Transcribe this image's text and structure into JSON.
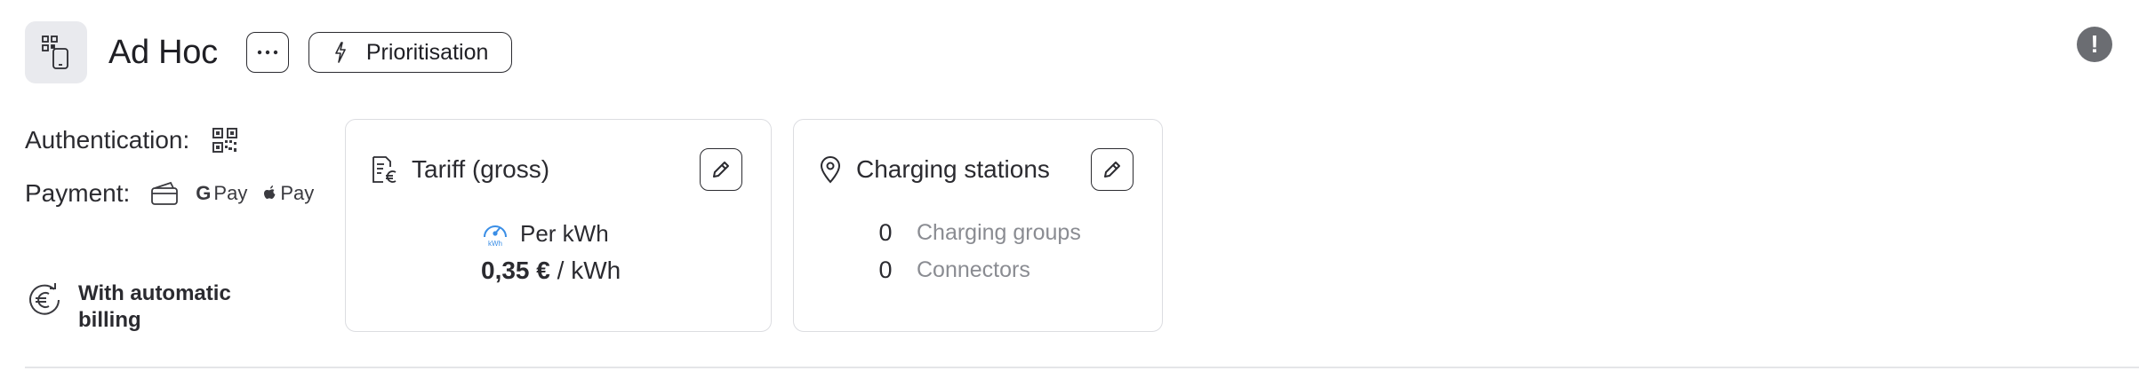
{
  "header": {
    "title": "Ad Hoc",
    "prioritisation_label": "Prioritisation",
    "app_icon": "qr-phone-icon",
    "more_icon": "ellipsis-icon",
    "prio_icon": "lightning-icon",
    "alert_icon": "exclamation-icon",
    "alert_symbol": "!"
  },
  "info": {
    "authentication_label": "Authentication:",
    "payment_label": "Payment:",
    "gpay_label": "Pay",
    "applepay_label": "Pay",
    "billing_label": "With automatic billing"
  },
  "tariff_card": {
    "title": "Tariff (gross)",
    "type_label": "Per kWh",
    "price": "0,35 €",
    "unit": "/ kWh"
  },
  "stations_card": {
    "title": "Charging stations",
    "stats": [
      {
        "count": "0",
        "label": "Charging groups"
      },
      {
        "count": "0",
        "label": "Connectors"
      }
    ]
  },
  "colors": {
    "tile_bg": "#e9eaee",
    "border": "#dcdde1",
    "muted_text": "#8a8c92",
    "accent_blue": "#3a8ee6",
    "alert_bg": "#6b6d72"
  }
}
